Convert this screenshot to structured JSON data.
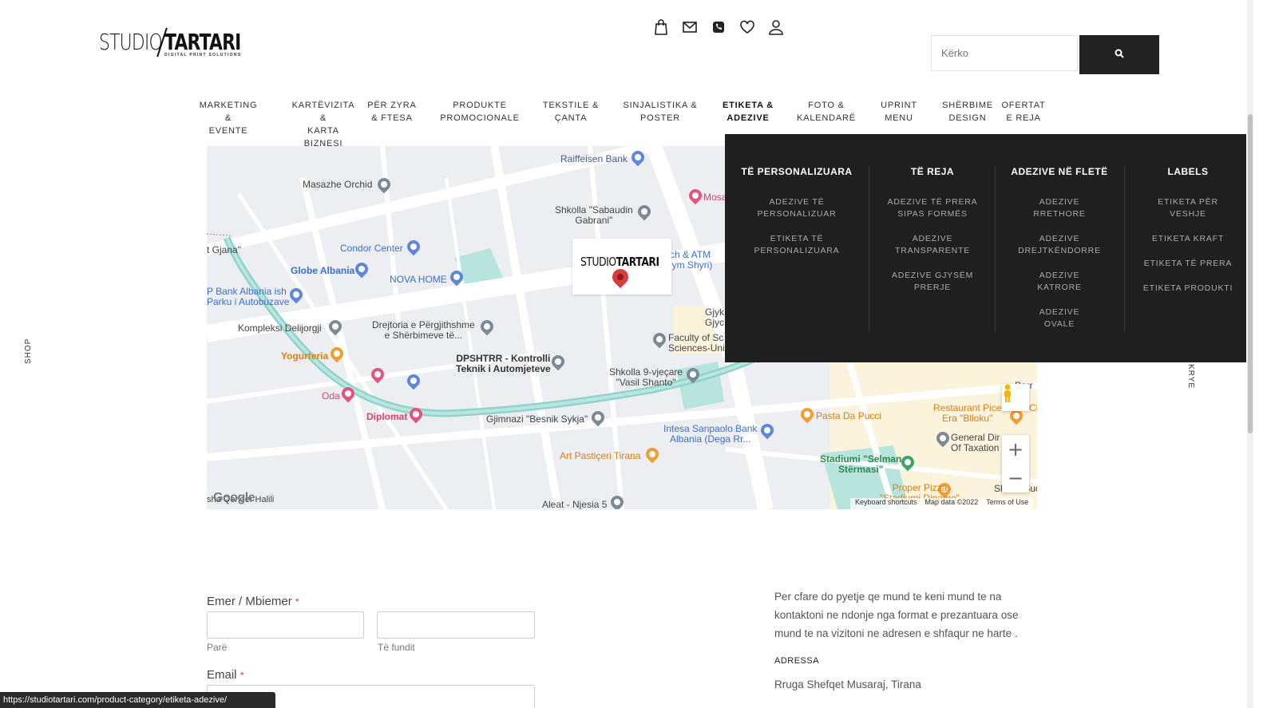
{
  "brand": {
    "logo_studio": "STUDIO",
    "logo_tartari": "TARTARI",
    "logo_tagline": "DIGITAL PRINT SOLUTIONS"
  },
  "header_icons": [
    "shopping-bag-icon",
    "mail-icon",
    "phone-icon",
    "heart-icon",
    "user-icon"
  ],
  "search": {
    "placeholder": "Kërko"
  },
  "nav": {
    "items": [
      {
        "label": "MARKETING &\nEVENTE"
      },
      {
        "label": "KARTËVIZITA &\nKARTA BIZNESI"
      },
      {
        "label": "PËR ZYRA\n& FTESA"
      },
      {
        "label": "PRODUKTE\nPROMOCIONALE"
      },
      {
        "label": "TEKSTILE &\nÇANTA"
      },
      {
        "label": "SINJALISTIKA &\nPOSTER"
      },
      {
        "label": "ETIKETA &\nADEZIVE",
        "active": true
      },
      {
        "label": "FOTO &\nKALENDARË"
      },
      {
        "label": "UPRINT\nMENU"
      },
      {
        "label": "SHËRBIME\nDESIGN"
      },
      {
        "label": "OFERTAT\nE REJA"
      }
    ]
  },
  "mega_menu": {
    "columns": [
      {
        "heading": "TË PERSONALIZUARA",
        "links": [
          "ADEZIVE TË\nPERSONALIZUAR",
          "ETIKETA TË\nPERSONALIZUARA"
        ]
      },
      {
        "heading": "TË REJA",
        "links": [
          "ADEZIVE TË PRERA\nSIPAS FORMËS",
          "ADEZIVE\nTRANSPARENTE",
          "ADEZIVE GJYSËM\nPRERJE"
        ]
      },
      {
        "heading": "ADEZIVE NË FLETË",
        "links": [
          "ADEZIVE\nRRETHORE",
          "ADEZIVE\nDREJTKËNDORRE",
          "ADEZIVE\nKATRORE",
          "ADEZIVE\nOVALE"
        ]
      },
      {
        "heading": "LABELS",
        "links": [
          "ETIKETA PËR\nVESHJE",
          "ETIKETA KRAFT",
          "ETIKETA TË PRERA",
          "ETIKETA PRODUKTI"
        ]
      }
    ]
  },
  "side": {
    "left": "SHOP",
    "right": "KRYE"
  },
  "map": {
    "logo_studio": "STUDIO",
    "logo_tartari": "TARTARI",
    "labels": [
      {
        "text": "Raiffeisen Bank",
        "color": "#4a5a8a"
      },
      {
        "text": "Masazhe Orchid",
        "color": "#444"
      },
      {
        "text": "Shkolla \"Sabaudin\nGabrani\"",
        "color": "#444"
      },
      {
        "text": "Mosa",
        "color": "#d2466f"
      },
      {
        "text": "t Gjana\"",
        "color": "#444"
      },
      {
        "text": "Condor Center",
        "color": "#3b6fcf"
      },
      {
        "text": "Globe Albania",
        "color": "#3b6fcf"
      },
      {
        "text": "NOVA HOME",
        "color": "#3b6fcf"
      },
      {
        "text": "ch & ATM\nlym Shyri)",
        "color": "#3b6fcf"
      },
      {
        "text": "P Bank Albania ish\nParku i Autobuzave",
        "color": "#3b6fcf"
      },
      {
        "text": "Kompleksi Delijorgji",
        "color": "#444"
      },
      {
        "text": "Drejtoria e Përgjithshme\ne Shërbimeve të...",
        "color": "#444"
      },
      {
        "text": "Gjyk\nGjyc",
        "color": "#444"
      },
      {
        "text": "Faculty of Sc\nSciences-Uni",
        "color": "#444"
      },
      {
        "text": "Yogurteria",
        "color": "#d97f12"
      },
      {
        "text": "DPSHTRR - Kontrolli\nTeknik i Automjeteve",
        "color": "#333"
      },
      {
        "text": "Shkolla 9-vjeçare\n\"Vasil Shanto\"",
        "color": "#444"
      },
      {
        "text": "Oda",
        "color": "#d2466f"
      },
      {
        "text": "Diplomat",
        "color": "#d2466f"
      },
      {
        "text": "Gjimnazi \"Besnik Sykja\"",
        "color": "#444"
      },
      {
        "text": "Pasta Da Pucci",
        "color": "#d97f12"
      },
      {
        "text": "Restaurant Pice\nEra \"Blloku\"",
        "color": "#d97f12"
      },
      {
        "text": "Intesa Sanpaolo Bank\nAlbania (Dega Rr...",
        "color": "#3b6fcf"
      },
      {
        "text": "General Dir\nOf Taxation",
        "color": "#444"
      },
      {
        "text": "Art Pastiçeri Tirana",
        "color": "#d97f12"
      },
      {
        "text": "Stadiumi \"Selman\nStërmasi\"",
        "color": "#2a8a4f"
      },
      {
        "text": "Proper Pizza\n\"Stadiumi Dinamo\"",
        "color": "#d97f12"
      },
      {
        "text": "Aleat - Njesia 5",
        "color": "#444"
      },
      {
        "text": "Shesh Suo",
        "color": "#444"
      },
      {
        "text": "Ci",
        "color": "#d97f12"
      },
      {
        "text": "Parr",
        "color": "#444"
      },
      {
        "text": "sha Qender Halili",
        "color": "#444"
      }
    ],
    "google": "Google",
    "footer": [
      "Keyboard shortcuts",
      "Map data ©2022",
      "Terms of Use"
    ]
  },
  "form": {
    "name_label": "Emer / Mbiemer",
    "required_mark": "*",
    "first_sub": "Parë",
    "last_sub": "Të fundit",
    "email_label": "Email"
  },
  "info": {
    "text": "Per cfare do pyetje qe mund te keni mund te na kontaktoni ne ndonje nga format e prezantuara ose mund te na vizitoni ne adresen e shfaqur ne harte .",
    "heading": "ADRESSA",
    "address": "Rruga Shefqet Musaraj, Tirana"
  },
  "status_bar": {
    "url": "https://studiotartari.com/product-category/etiketa-adezive/"
  }
}
